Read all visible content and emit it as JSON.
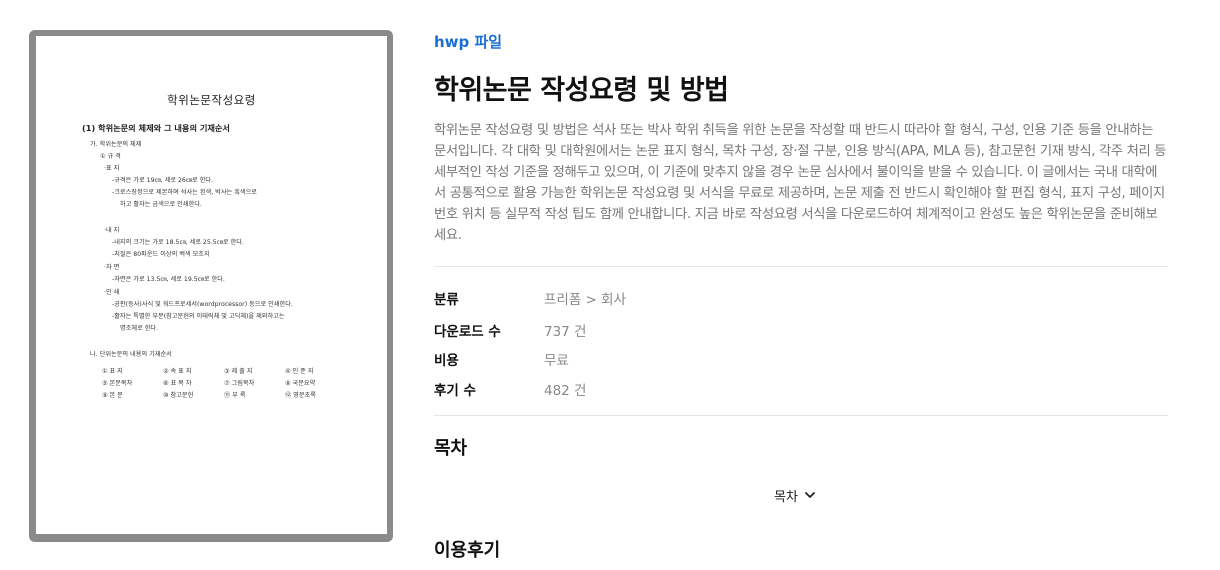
{
  "preview": {
    "title": "학위논문작성요령",
    "heading": "(1) 학위논문의 체제와 그 내용의 기재순서",
    "lines": [
      "가. 학위논문의 체제",
      "① 규     격",
      "·표     지",
      "-규격은 가로 19㎝, 세로 26㎝로 한다.",
      "-크로스장정으로 제본하며 석사는 흰색, 박사는 흑색으로",
      "하고 활자는 금색으로 인쇄한다.",
      "·내     지",
      "-내지의 크기는 가로 18.5㎝, 세로 25.5㎝로 한다.",
      "-지질은 80파운드 이상의 백색 모조지",
      "·자     면",
      "-자면은 가로 13.5㎝, 세로 19.5㎝로 한다.",
      "·인     쇄",
      "-공판(등사)사식 및 워드프로세서(wordprocessor) 등으로 인쇄한다.",
      "-활자는 특별한 부분(참고문헌의 이태릭체 및 고딕체)을 제외하고는",
      "명조체로 한다.",
      "나. 단위논문의 내용의 기재순서"
    ],
    "grid": [
      [
        "① 표     지",
        "② 속 표 지",
        "③ 제 출 지",
        "④ 인 준 지"
      ],
      [
        "⑤ 본문목차",
        "⑥ 표 목 차",
        "⑦ 그림목차",
        "⑧ 국문요약"
      ],
      [
        "⑨ 본     문",
        "⑩ 참고문헌",
        "⑪ 부     록",
        "⑫ 영문초록"
      ]
    ]
  },
  "doc": {
    "category": "hwp 파일",
    "title": "학위논문 작성요령 및 방법",
    "description": "학위논문 작성요령 및 방법은 석사 또는 박사 학위 취득을 위한 논문을 작성할 때 반드시 따라야 할 형식, 구성, 인용 기준 등을 안내하는 문서입니다. 각 대학 및 대학원에서는 논문 표지 형식, 목차 구성, 장·절 구분, 인용 방식(APA, MLA 등), 참고문헌 기재 방식, 각주 처리 등 세부적인 작성 기준을 정해두고 있으며, 이 기준에 맞추지 않을 경우 논문 심사에서 불이익을 받을 수 있습니다. 이 글에서는 국내 대학에서 공통적으로 활용 가능한 학위논문 작성요령 및 서식을 무료로 제공하며, 논문 제출 전 반드시 확인해야 할 편집 형식, 표지 구성, 페이지 번호 위치 등 실무적 작성 팁도 함께 안내합니다. 지금 바로 작성요령 서식을 다운로드하여 체계적이고 완성도 높은 학위논문을 준비해보세요."
  },
  "meta": [
    {
      "label": "분류",
      "value": "프리폼 > 회사"
    },
    {
      "label": "다운로드 수",
      "value": "737 건"
    },
    {
      "label": "비용",
      "value": "무료"
    },
    {
      "label": "후기 수",
      "value": "482 건"
    }
  ],
  "toc": {
    "section_title": "목차",
    "toggle_label": "목차",
    "toggle_icon": "chevron-down-icon"
  },
  "reviews": {
    "section_title": "이용후기"
  }
}
